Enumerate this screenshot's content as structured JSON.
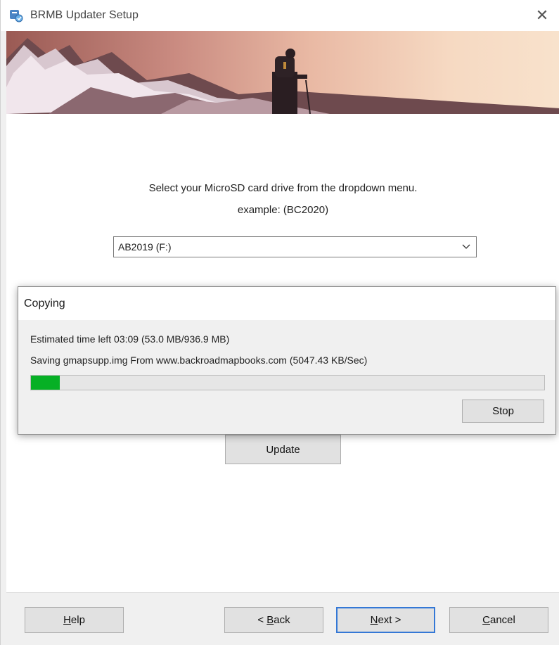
{
  "window": {
    "title": "BRMB Updater Setup",
    "close_glyph": "✕"
  },
  "main": {
    "instruction": "Select your MicroSD card drive from the dropdown menu.",
    "example": "example: (BC2020)",
    "drive_select": {
      "selected": "AB2019 (F:)"
    },
    "update_label": "Update"
  },
  "copy_dialog": {
    "title": "Copying",
    "estimate": "Estimated time left 03:09 (53.0 MB/936.9 MB)",
    "saving": "Saving gmapsupp.img From www.backroadmapbooks.com (5047.43 KB/Sec)",
    "progress_fraction": 0.0566,
    "stop_label": "Stop"
  },
  "footer": {
    "help_accel": "H",
    "help_rest": "elp",
    "back_prefix": "< ",
    "back_accel": "B",
    "back_rest": "ack",
    "next_accel": "N",
    "next_rest": "ext >",
    "cancel_accel": "C",
    "cancel_rest": "ancel"
  },
  "colors": {
    "progress_green": "#06b025",
    "default_button_border": "#3478d6"
  },
  "icons": [
    "setup-app-icon",
    "close-icon",
    "chevron-down-icon"
  ]
}
